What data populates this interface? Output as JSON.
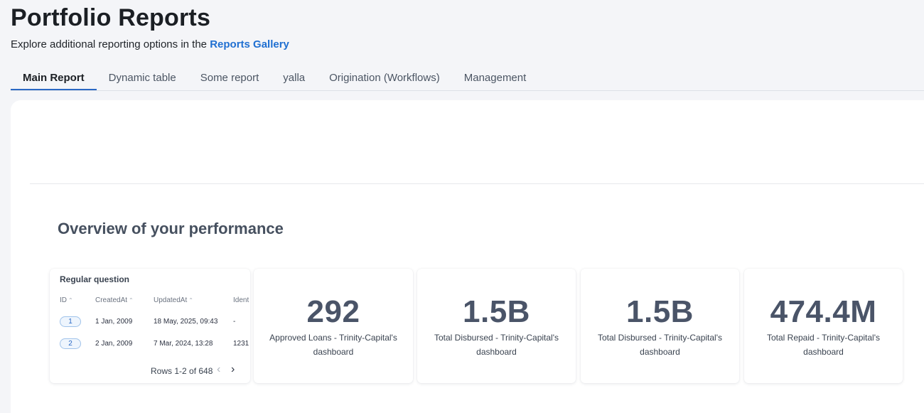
{
  "header": {
    "title": "Portfolio Reports",
    "subtitle_prefix": "Explore additional reporting options in the ",
    "subtitle_link": "Reports Gallery"
  },
  "tabs": [
    {
      "label": "Main Report",
      "active": true
    },
    {
      "label": "Dynamic table"
    },
    {
      "label": "Some report"
    },
    {
      "label": "yalla"
    },
    {
      "label": "Origination (Workflows)"
    },
    {
      "label": "Management"
    }
  ],
  "overview": {
    "title": "Overview of your performance"
  },
  "table_card": {
    "title": "Regular question",
    "columns": [
      "ID",
      "CreatedAt",
      "UpdatedAt",
      "Ident"
    ],
    "rows": [
      {
        "id": "1",
        "created": "1 Jan, 2009",
        "updated": "18 May, 2025, 09:43",
        "ident": "-"
      },
      {
        "id": "2",
        "created": "2 Jan, 2009",
        "updated": "7 Mar, 2024, 13:28",
        "ident": "1231"
      }
    ],
    "pager": "Rows 1-2 of 648"
  },
  "scalars": [
    {
      "value": "292",
      "label": "Approved Loans - Trinity-Capital's dashboard"
    },
    {
      "value": "1.5B",
      "label": "Total Disbursed - Trinity-Capital's dashboard"
    },
    {
      "value": "1.5B",
      "label": "Total Disbursed - Trinity-Capital's dashboard"
    },
    {
      "value": "474.4M",
      "label": "Total Repaid - Trinity-Capital's dashboard"
    }
  ],
  "icons": {
    "sort": "sort-up-icon",
    "prev": "chevron-left-icon",
    "next": "chevron-right-icon"
  },
  "colors": {
    "accent": "#2a68c4",
    "link": "#1f6fd1",
    "scalar_value": "#4a5468"
  }
}
